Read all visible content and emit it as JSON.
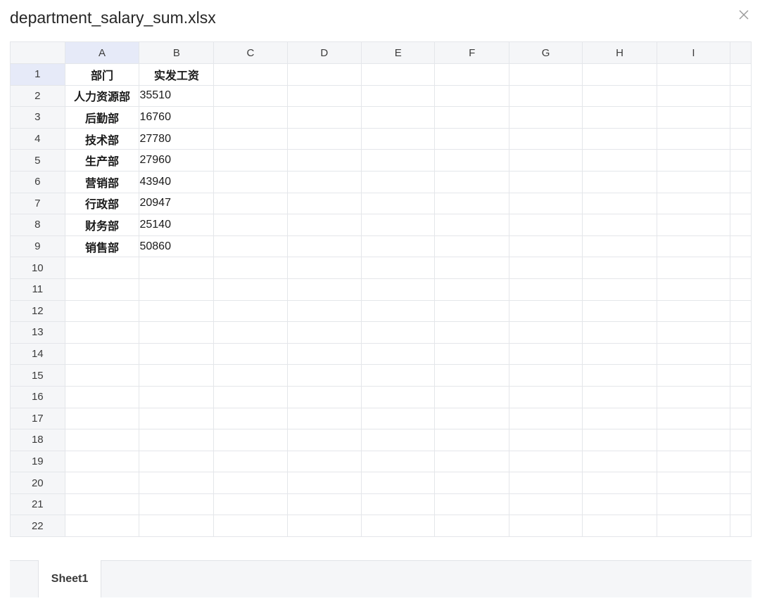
{
  "window": {
    "title": "department_salary_sum.xlsx",
    "close_icon": "close-icon"
  },
  "columns": [
    "A",
    "B",
    "C",
    "D",
    "E",
    "F",
    "G",
    "H",
    "I"
  ],
  "active_column": "A",
  "active_row": 1,
  "row_count": 22,
  "rows": [
    {
      "num": 1,
      "A": "部门",
      "B": "实发工资"
    },
    {
      "num": 2,
      "A": "人力资源部",
      "B": "35510"
    },
    {
      "num": 3,
      "A": "后勤部",
      "B": "16760"
    },
    {
      "num": 4,
      "A": "技术部",
      "B": "27780"
    },
    {
      "num": 5,
      "A": "生产部",
      "B": "27960"
    },
    {
      "num": 6,
      "A": "营销部",
      "B": "43940"
    },
    {
      "num": 7,
      "A": "行政部",
      "B": "20947"
    },
    {
      "num": 8,
      "A": "财务部",
      "B": "25140"
    },
    {
      "num": 9,
      "A": "销售部",
      "B": "50860"
    },
    {
      "num": 10
    },
    {
      "num": 11
    },
    {
      "num": 12
    },
    {
      "num": 13
    },
    {
      "num": 14
    },
    {
      "num": 15
    },
    {
      "num": 16
    },
    {
      "num": 17
    },
    {
      "num": 18
    },
    {
      "num": 19
    },
    {
      "num": 20
    },
    {
      "num": 21
    },
    {
      "num": 22
    }
  ],
  "sheets": [
    {
      "label": "Sheet1",
      "active": true
    }
  ],
  "colors": {
    "header_bg": "#f5f6f8",
    "active_header_bg": "#e6eaf8",
    "gridline": "#e4e6ea",
    "data_border": "#4a4a4a"
  }
}
